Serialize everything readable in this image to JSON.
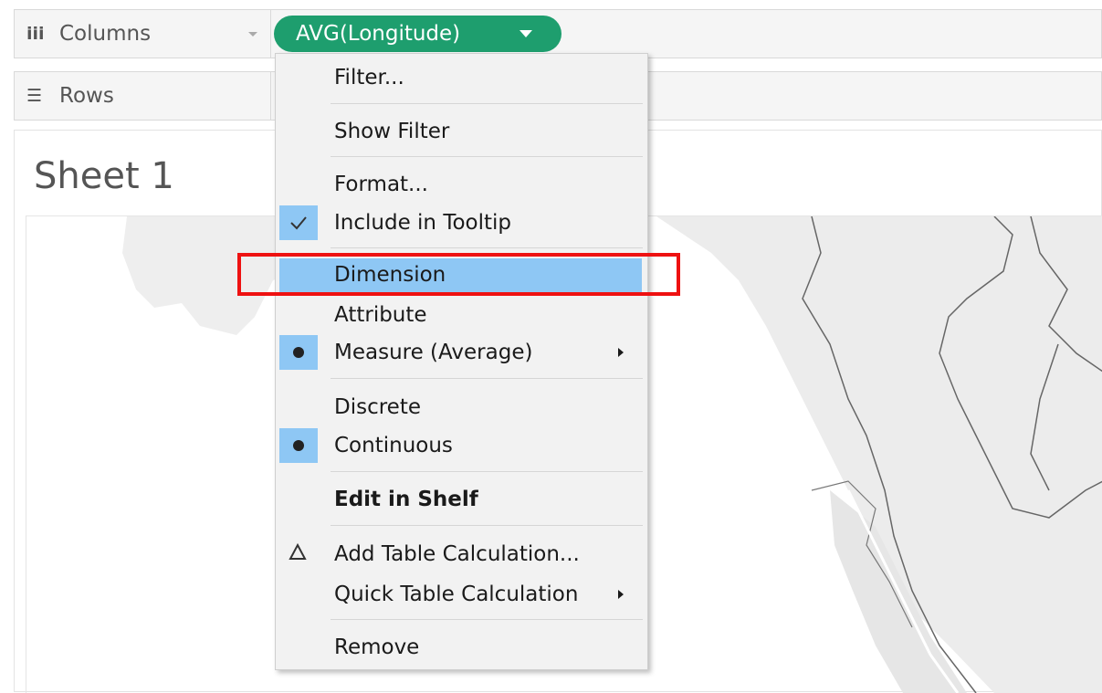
{
  "shelves": {
    "columns_label": "Columns",
    "rows_label": "Rows"
  },
  "pill": {
    "label": "AVG(Longitude)",
    "color": "#1e9e6e"
  },
  "sheet": {
    "title": "Sheet 1"
  },
  "menu": {
    "filter": "Filter...",
    "show_filter": "Show Filter",
    "format": "Format...",
    "include_in_tooltip": "Include in Tooltip",
    "dimension": "Dimension",
    "attribute": "Attribute",
    "measure_average": "Measure (Average)",
    "discrete": "Discrete",
    "continuous": "Continuous",
    "edit_in_shelf": "Edit in Shelf",
    "add_table_calculation": "Add Table Calculation...",
    "quick_table_calculation": "Quick Table Calculation",
    "remove": "Remove"
  },
  "colors": {
    "menu_highlight": "#8ec7f4",
    "annotation_box": "#ee1111"
  }
}
